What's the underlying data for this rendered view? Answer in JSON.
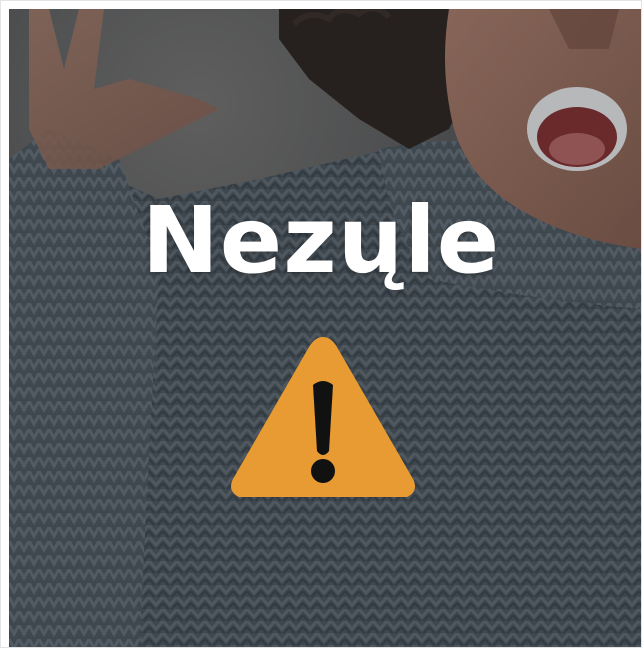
{
  "card": {
    "headline": "Nezųle",
    "icon": "warning-triangle-icon"
  },
  "colors": {
    "warning_fill": "#E89B33",
    "warning_mark": "#111111",
    "headline_text": "#FFFFFF",
    "sweater": "#4E5A63"
  }
}
